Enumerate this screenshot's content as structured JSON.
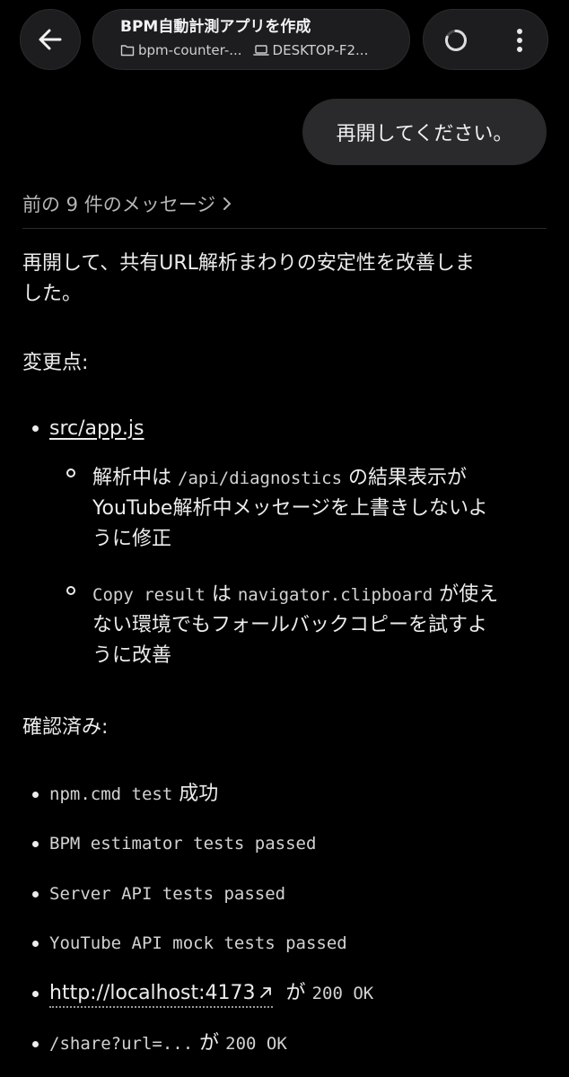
{
  "header": {
    "title": "BPM自動計測アプリを作成",
    "folder": "bpm-counter-...",
    "device": "DESKTOP-F2..."
  },
  "user_message": "再開してください。",
  "prev_messages": "前の 9 件のメッセージ",
  "reply": {
    "intro_line1": "再開して、共有URL解析まわりの安定性を改善しま",
    "intro_line2": "した。",
    "changes_heading": "変更点:",
    "file_link": "src/app.js",
    "sub1": {
      "p1": "解析中は ",
      "code": "/api/diagnostics",
      "p2": " の結果表示が",
      "line2": "YouTube解析中メッセージを上書きしないよ",
      "line3": "うに修正"
    },
    "sub2": {
      "code1": "Copy result",
      "p1": " は ",
      "code2": "navigator.clipboard",
      "p2": " が使え",
      "line2": "ない環境でもフォールバックコピーを試すよ",
      "line3": "うに改善"
    },
    "verified_heading": "確認済み:",
    "checks": {
      "c1_code": "npm.cmd test",
      "c1_text": " 成功",
      "c2": "BPM estimator tests passed",
      "c3": "Server API tests passed",
      "c4": "YouTube API mock tests passed",
      "c5_link": "http://localhost:4173",
      "c5_text": " が ",
      "c5_code": "200 OK",
      "c6_code": "/share?url=...",
      "c6_text": " が ",
      "c6_code2": "200 OK"
    }
  },
  "icons": {
    "back": "arrow-left-icon",
    "folder": "folder-icon",
    "laptop": "laptop-icon",
    "spinner": "loading-spinner-icon",
    "more": "more-vertical-icon",
    "chevron": "chevron-right-icon",
    "external": "external-link-icon"
  }
}
